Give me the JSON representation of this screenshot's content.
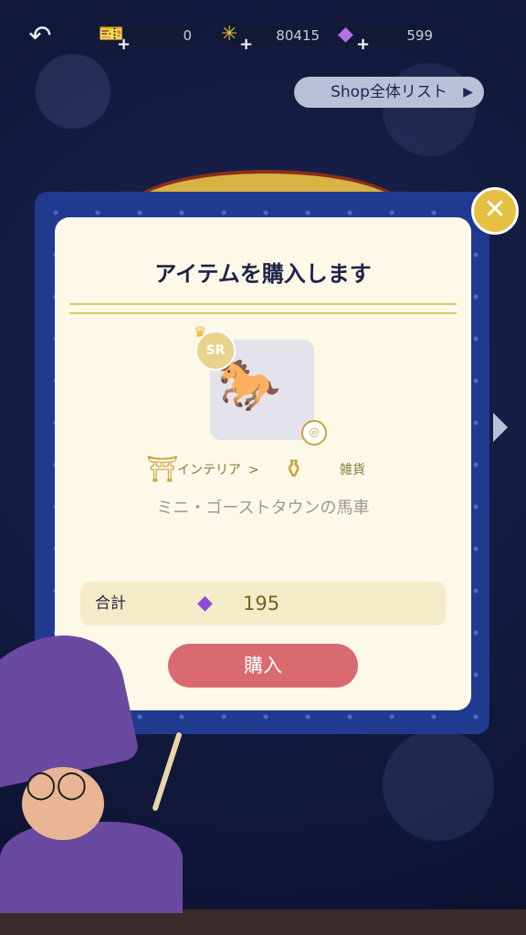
{
  "header": {
    "back_icon": "undo-arrow-icon",
    "currencies": [
      {
        "icon": "ticket-icon",
        "value": "0"
      },
      {
        "icon": "sparkle-icon",
        "value": "80415"
      },
      {
        "icon": "gem-icon",
        "value": "599"
      }
    ],
    "shop_list_label": "Shop全体リスト"
  },
  "modal": {
    "title": "アイテムを購入します",
    "item": {
      "rarity": "SR",
      "name": "ミニ・ゴーストタウンの馬車",
      "category": "インテリア",
      "subcategory": "雑貨"
    },
    "total_label": "合計",
    "total_value": "195",
    "buy_label": "購入"
  }
}
